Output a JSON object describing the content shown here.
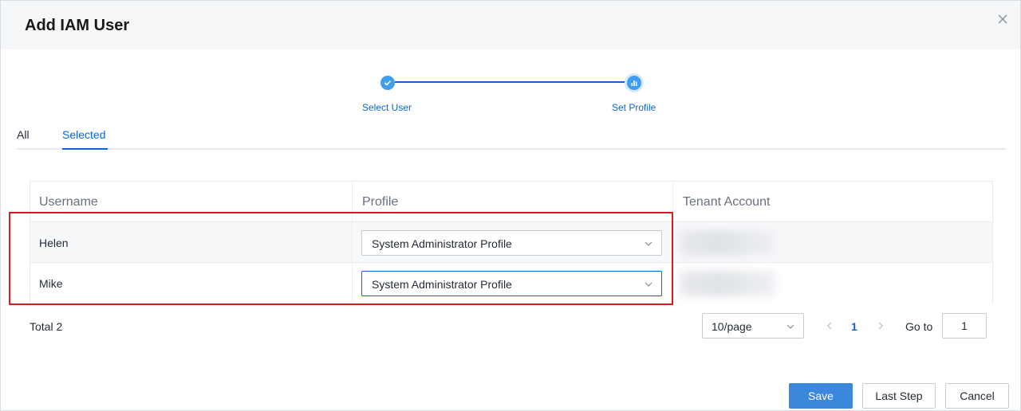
{
  "dialog": {
    "title": "Add IAM User",
    "close_icon": "close-icon"
  },
  "stepper": {
    "steps": [
      {
        "label": "Select User",
        "state": "done",
        "icon": "check-icon"
      },
      {
        "label": "Set Profile",
        "state": "current",
        "icon": "bar-chart-icon"
      }
    ],
    "accent": "#0a66d8"
  },
  "tabs": [
    {
      "label": "All",
      "active": false
    },
    {
      "label": "Selected",
      "active": true
    }
  ],
  "table": {
    "columns": [
      "Username",
      "Profile",
      "Tenant Account"
    ],
    "rows": [
      {
        "username": "Helen",
        "profile": "System Administrator Profile"
      },
      {
        "username": "Mike",
        "profile": "System Administrator Profile"
      }
    ]
  },
  "pagination": {
    "total_label": "Total 2",
    "page_size": "10/page",
    "current_page": "1",
    "goto_label": "Go to",
    "goto_value": "1"
  },
  "footer": {
    "save_label": "Save",
    "last_step_label": "Last Step",
    "cancel_label": "Cancel"
  },
  "colors": {
    "primary": "#3b87dc",
    "highlight_border": "#d41f1f"
  }
}
